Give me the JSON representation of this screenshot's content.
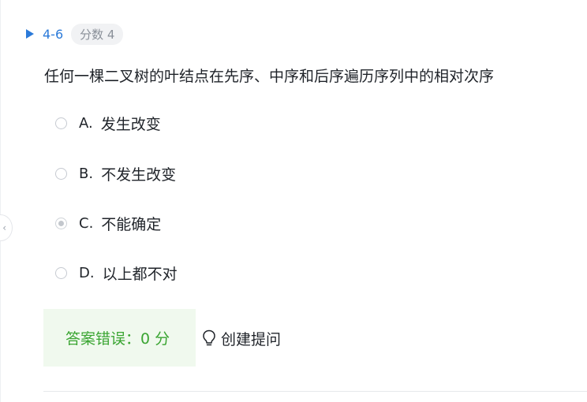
{
  "question": {
    "number": "4-6",
    "score_badge": "分数 4",
    "text": "任何一棵二叉树的叶结点在先序、中序和后序遍历序列中的相对次序",
    "options": [
      {
        "letter": "A.",
        "text": "发生改变",
        "selected": false
      },
      {
        "letter": "B.",
        "text": "不发生改变",
        "selected": false
      },
      {
        "letter": "C.",
        "text": "不能确定",
        "selected": true
      },
      {
        "letter": "D.",
        "text": "以上都不对",
        "selected": false
      }
    ]
  },
  "result": {
    "text": "答案错误：0 分"
  },
  "actions": {
    "ask_label": "创建提问"
  },
  "colors": {
    "accent": "#2b7ad9",
    "result_bg": "#f0f9ee",
    "result_text": "#3aa532"
  }
}
